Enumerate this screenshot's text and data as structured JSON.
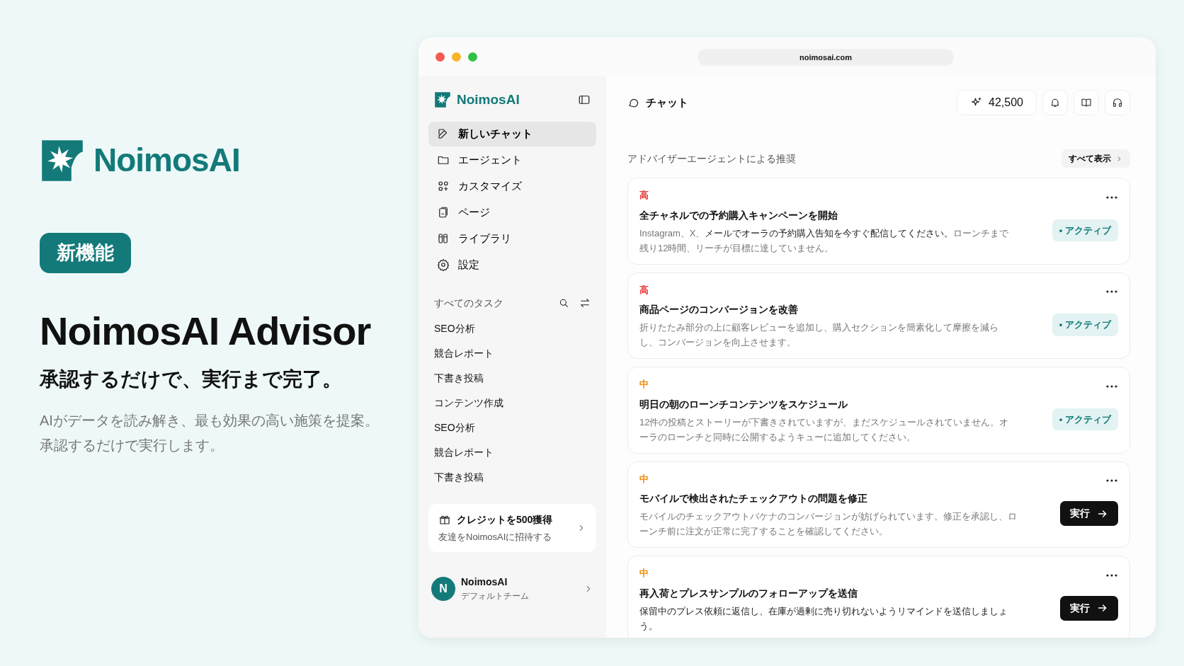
{
  "promo": {
    "brand": "NoimosAI",
    "badge": "新機能",
    "heading": "NoimosAI Advisor",
    "tagline": "承認するだけで、実行まで完了。",
    "description": [
      "AIがデータを読み解き、最も効果の高い施策を提案。",
      "承認するだけで実行します。"
    ]
  },
  "window": {
    "url": "noimosai.com"
  },
  "sidebar": {
    "brand": "NoimosAI",
    "nav": [
      {
        "kind": "edit",
        "label": "新しいチャット",
        "selected": true
      },
      {
        "kind": "folder",
        "label": "エージェント",
        "selected": false
      },
      {
        "kind": "customize",
        "label": "カスタマイズ",
        "selected": false
      },
      {
        "kind": "page",
        "label": "ページ",
        "selected": false
      },
      {
        "kind": "library",
        "label": "ライブラリ",
        "selected": false
      },
      {
        "kind": "settings",
        "label": "設定",
        "selected": false
      }
    ],
    "tasks_header": "すべてのタスク",
    "tasks": [
      "SEO分析",
      "競合レポート",
      "下書き投稿",
      "コンテンツ作成",
      "SEO分析",
      "競合レポート",
      "下書き投稿"
    ],
    "promo_card": {
      "title": "クレジットを500獲得",
      "subtitle": "友達をNoimosAIに招待する"
    },
    "user": {
      "initial": "N",
      "name": "NoimosAI",
      "team": "デフォルトチーム"
    }
  },
  "header": {
    "title": "チャット",
    "credits": "42,500"
  },
  "recommendations": {
    "title": "アドバイザーエージェントによる推奨",
    "view_all": "すべて表示",
    "items": [
      {
        "priority": "高",
        "color": "#e53935",
        "title": "全チャネルでの予約購入キャンペーンを開始",
        "description": "Instagram、X、**メールでオーラの予約購入告知を今すぐ配信してください。**ローンチまで残り12時間、リーチが目標に達していません。",
        "kind": "status",
        "action": "• アクティブ"
      },
      {
        "priority": "高",
        "color": "#e53935",
        "title": "商品ページのコンバージョンを改善",
        "description": "折りたたみ部分の上に顧客レビューを追加し、購入セクションを簡素化して摩擦を減らし、コンバージョンを向上させます。",
        "kind": "status",
        "action": "• アクティブ"
      },
      {
        "priority": "中",
        "color": "#f08a00",
        "title": "明日の朝のローンチコンテンツをスケジュール",
        "description": "12件の投稿とストーリーが下書きされていますが、まだスケジュールされていません。オーラのローンチと同時に公開するようキューに追加してください。",
        "kind": "status",
        "action": "• アクティブ"
      },
      {
        "priority": "中",
        "color": "#f08a00",
        "title": "モバイルで検出されたチェックアウトの問題を修正",
        "description": "モバイルのチェックアウトバケナのコンバージョンが妨げられています。修正を承認し、ローンチ前に注文が正常に完了することを確認してください。",
        "kind": "run",
        "action": "実行"
      },
      {
        "priority": "中",
        "color": "#f08a00",
        "title": "再入荷とプレスサンプルのフォローアップを送信",
        "description": "**保留中のプレス依頼に返信し、在庫が過剰に売り切れないようリマインドを送信しましょう。**",
        "kind": "run",
        "action": "実行"
      }
    ]
  }
}
